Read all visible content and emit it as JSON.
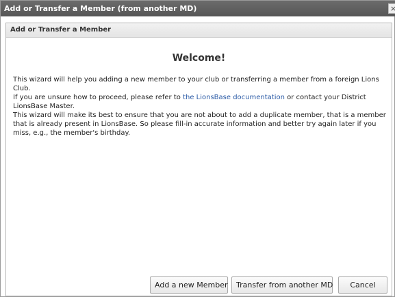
{
  "window": {
    "title": "Add or Transfer a Member (from another MD)",
    "close_label": "×"
  },
  "panel": {
    "header": "Add or Transfer a Member",
    "welcome": "Welcome!",
    "line1": "This wizard will help you adding a new member to your club or transferring a member from a foreign Lions Club.",
    "line2_before": "If you are unsure how to proceed, please refer to ",
    "line2_link": "the LionsBase documentation",
    "line2_after": " or contact your District LionsBase Master.",
    "line3": "This wizard will make its best to ensure that you are not about to add a duplicate member, that is a member that is already present in LionsBase. So please fill-in accurate information and better try again later if you miss, e.g., the member's birthday."
  },
  "buttons": {
    "add_label": "Add a new Member",
    "transfer_label": "Transfer from another MD",
    "cancel_label": "Cancel"
  }
}
